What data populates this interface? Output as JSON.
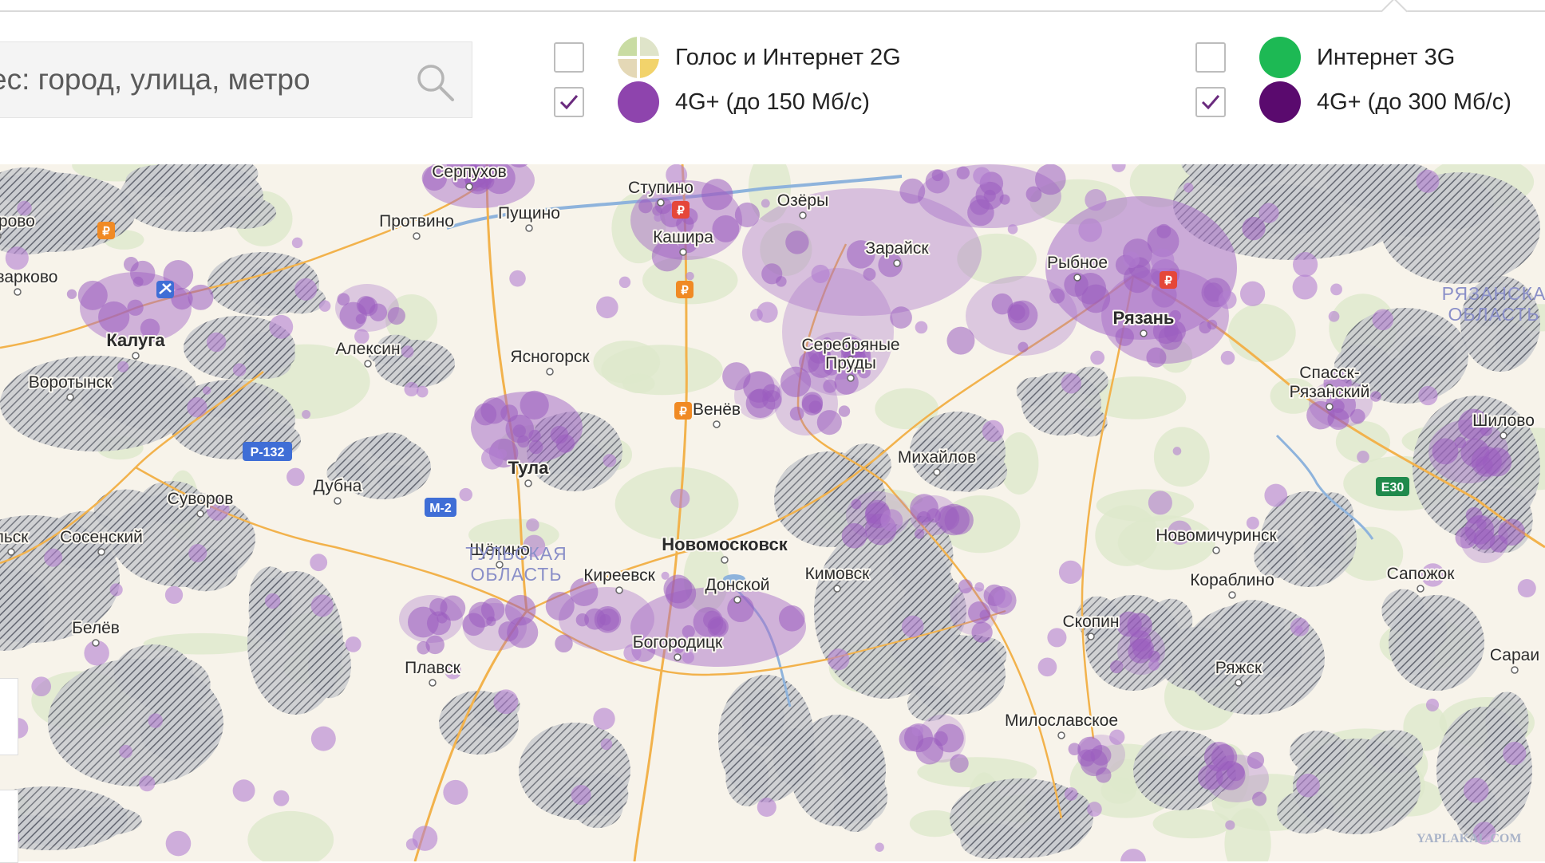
{
  "search": {
    "placeholder": "ес: город, улица, метро"
  },
  "legend": [
    {
      "label": "Голос и Интернет 2G",
      "checked": false,
      "color": "#cfd9a8"
    },
    {
      "label": "Интернет 3G",
      "checked": false,
      "color": "#1db954"
    },
    {
      "label": "4G+ (до 150 Мб/с)",
      "checked": true,
      "color": "#8e44ad"
    },
    {
      "label": "4G+ (до 300 Мб/с)",
      "checked": true,
      "color": "#5a0a6e"
    }
  ],
  "map": {
    "colors": {
      "coverage": "#a066c2",
      "hatch": "#6f7380",
      "road_major": "#f2b24c",
      "road_minor": "#ffffff",
      "water": "#7fa8d8",
      "forest": "#d8e6c6"
    },
    "cities": [
      {
        "name": "Серпухов"
      },
      {
        "name": "Ступино"
      },
      {
        "name": "Пущино"
      },
      {
        "name": "Озёры"
      },
      {
        "name": "Кондрово"
      },
      {
        "name": "Протвино"
      },
      {
        "name": "Кашира"
      },
      {
        "name": "Зарайск"
      },
      {
        "name": "Рыбное"
      },
      {
        "name": "Товарково"
      },
      {
        "name": "Рязань"
      },
      {
        "name": "Калуга"
      },
      {
        "name": "Алексин"
      },
      {
        "name": "Ясногорск"
      },
      {
        "name": "Серебряные"
      },
      {
        "name": "Пруды"
      },
      {
        "name": "Воротынск"
      },
      {
        "name": "Спасск-"
      },
      {
        "name": "Рязанский"
      },
      {
        "name": "Венёв"
      },
      {
        "name": "Шилово"
      },
      {
        "name": "Михайлов"
      },
      {
        "name": "Тула"
      },
      {
        "name": "Дубна"
      },
      {
        "name": "Суворов"
      },
      {
        "name": "льск"
      },
      {
        "name": "Сосенский"
      },
      {
        "name": "Новомичуринск"
      },
      {
        "name": "Щёкино"
      },
      {
        "name": "Новомосковск"
      },
      {
        "name": "Киреевск"
      },
      {
        "name": "Кимовск"
      },
      {
        "name": "Донской"
      },
      {
        "name": "Кораблино"
      },
      {
        "name": "Сапожок"
      },
      {
        "name": "Белёв"
      },
      {
        "name": "Скопин"
      },
      {
        "name": "Богородицк"
      },
      {
        "name": "Сараи"
      },
      {
        "name": "Плавск"
      },
      {
        "name": "Ряжск"
      },
      {
        "name": "Милославское"
      }
    ],
    "regions": [
      {
        "line1": "ТУЛЬСКАЯ",
        "line2": "ОБЛАСТЬ"
      },
      {
        "line1": "РЯЗАНСКА",
        "line2": "ОБЛАСТЬ"
      }
    ],
    "road_badges": [
      {
        "text": "Р-132",
        "color": "#3f6ed6"
      },
      {
        "text": "М-2",
        "color": "#3f6ed6"
      },
      {
        "text": "E30",
        "color": "#1f8a4c"
      }
    ],
    "watermark": "YAPLAKAL.COM"
  }
}
